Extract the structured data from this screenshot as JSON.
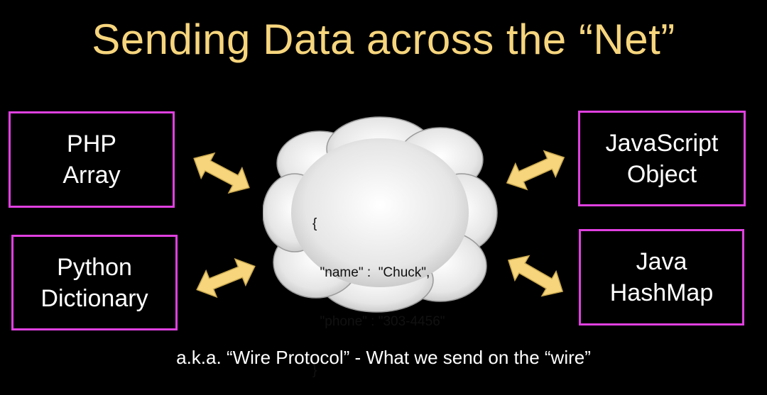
{
  "title": "Sending Data across the “Net”",
  "boxes": {
    "php": "PHP\nArray",
    "python": "Python\nDictionary",
    "javascript": "JavaScript\nObject",
    "java": "Java\nHashMap"
  },
  "cloud": {
    "json_lines": [
      "{",
      "  \"name\" :  \"Chuck\",",
      "  \"phone\" : \"303-4456\"",
      "}"
    ]
  },
  "footer": "a.k.a.  “Wire Protocol” - What we send on the “wire”",
  "colors": {
    "title": "#f6d57d",
    "box_border": "#e040e0",
    "arrow": "#f6d57d"
  }
}
